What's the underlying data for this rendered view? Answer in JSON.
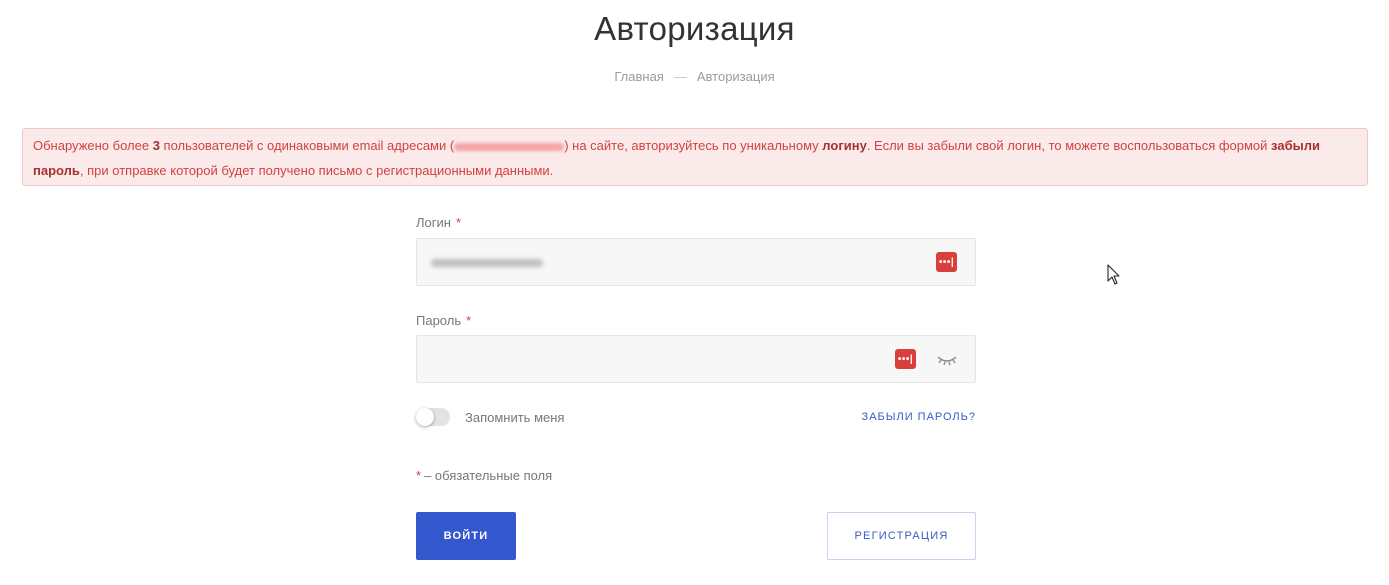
{
  "header": {
    "title": "Авторизация",
    "breadcrumb": [
      "Главная",
      "Авторизация"
    ]
  },
  "alert": {
    "part1": "Обнаружено более ",
    "count": "3",
    "part2": " пользователей с одинаковыми email адресами (",
    "part3": ") на сайте, авторизуйтесь по уникальному ",
    "login_word": "логину",
    "part4": ". Если вы забыли свой логин, то можете воспользоваться формой ",
    "forgot_word": "забыли пароль",
    "part5": ", при отправке которой будет получено письмо с регистрационными данными."
  },
  "form": {
    "login_label": "Логин",
    "password_label": "Пароль",
    "required_mark": "*",
    "pm_icon": "•••|",
    "remember_label": "Запомнить меня",
    "remember_checked": false,
    "forgot_link": "ЗАБЫЛИ ПАРОЛЬ?",
    "required_note": "– обязательные поля",
    "login_button": "ВОЙТИ",
    "register_button": "РЕГИСТРАЦИЯ"
  },
  "icons": {
    "password_manager": "password-manager-icon",
    "show_password": "eye-closed-icon",
    "cursor": "mouse-cursor-icon"
  },
  "colors": {
    "accent": "#3357cc",
    "error_text": "#d2423f",
    "alert_bg": "#fbeaea",
    "password_manager": "#d9403b"
  }
}
